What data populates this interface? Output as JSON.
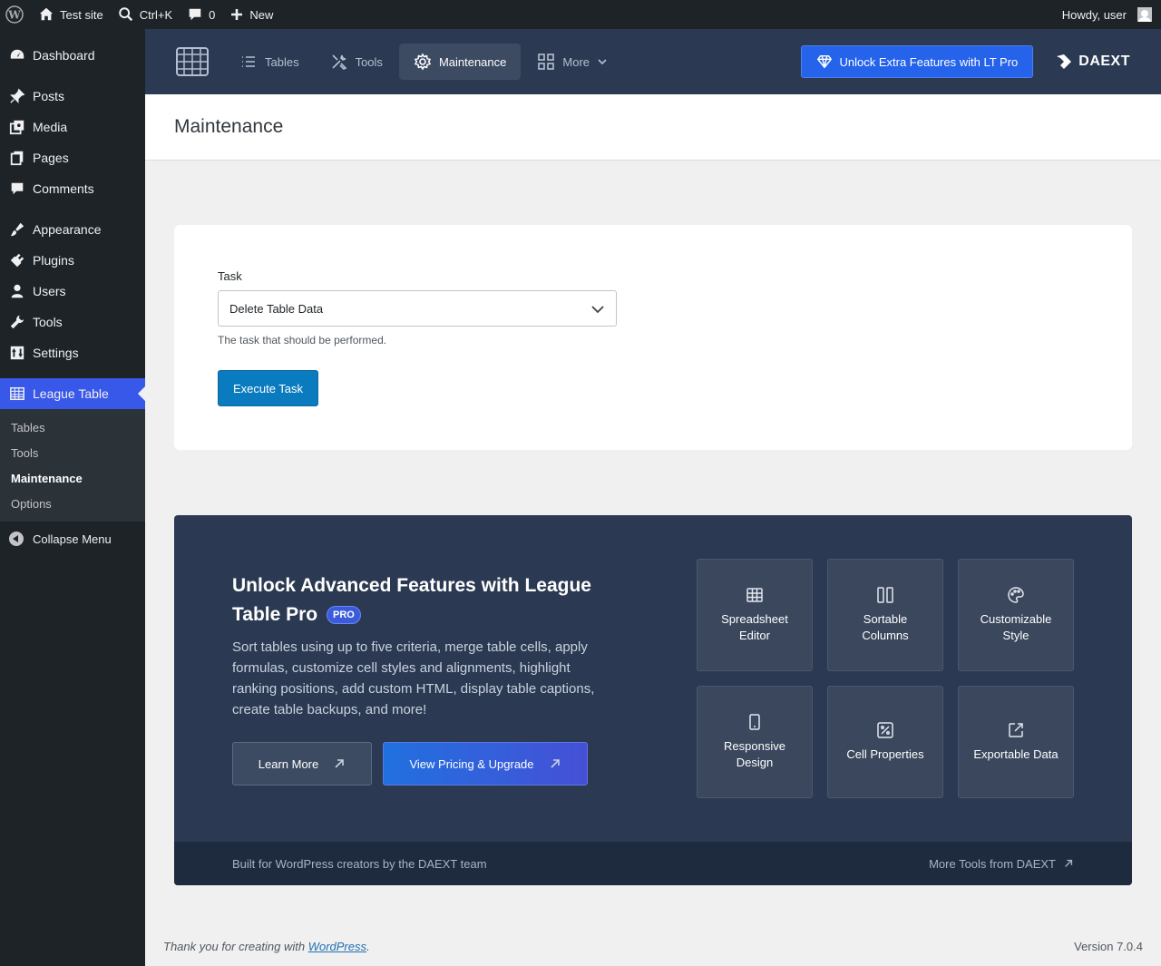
{
  "adminbar": {
    "site_name": "Test site",
    "search_shortcut": "Ctrl+K",
    "comments_count": "0",
    "new_label": "New",
    "howdy": "Howdy, user"
  },
  "sidebar": {
    "items": [
      {
        "label": "Dashboard",
        "icon": "dashboard-icon"
      },
      {
        "label": "Posts",
        "icon": "pin-icon"
      },
      {
        "label": "Media",
        "icon": "media-icon"
      },
      {
        "label": "Pages",
        "icon": "pages-icon"
      },
      {
        "label": "Comments",
        "icon": "comment-icon"
      },
      {
        "label": "Appearance",
        "icon": "brush-icon"
      },
      {
        "label": "Plugins",
        "icon": "plug-icon"
      },
      {
        "label": "Users",
        "icon": "user-icon"
      },
      {
        "label": "Tools",
        "icon": "wrench-icon"
      },
      {
        "label": "Settings",
        "icon": "settings-icon"
      },
      {
        "label": "League Table",
        "icon": "table-icon"
      }
    ],
    "submenu": [
      "Tables",
      "Tools",
      "Maintenance",
      "Options"
    ],
    "collapse_label": "Collapse Menu"
  },
  "plugin_nav": {
    "tabs": [
      "Tables",
      "Tools",
      "Maintenance",
      "More"
    ],
    "unlock_label": "Unlock Extra Features with LT Pro",
    "brand": "DAEXT"
  },
  "page": {
    "title": "Maintenance"
  },
  "task_form": {
    "label": "Task",
    "selected": "Delete Table Data",
    "help": "The task that should be performed.",
    "execute_label": "Execute Task"
  },
  "promo": {
    "title": "Unlock Advanced Features with League Table Pro",
    "badge": "PRO",
    "description": "Sort tables using up to five criteria, merge table cells, apply formulas, customize cell styles and alignments, highlight ranking positions, add custom HTML, display table captions, create table backups, and more!",
    "learn_more": "Learn More",
    "pricing": "View Pricing & Upgrade",
    "features": [
      {
        "label": "Spreadsheet Editor",
        "icon": "grid-icon"
      },
      {
        "label": "Sortable Columns",
        "icon": "columns-icon"
      },
      {
        "label": "Customizable Style",
        "icon": "palette-icon"
      },
      {
        "label": "Responsive Design",
        "icon": "mobile-icon"
      },
      {
        "label": "Cell Properties",
        "icon": "percent-icon"
      },
      {
        "label": "Exportable Data",
        "icon": "export-icon"
      }
    ],
    "footer_left": "Built for WordPress creators by the DAEXT team",
    "footer_right": "More Tools from DAEXT"
  },
  "footer": {
    "thanks_prefix": "Thank you for creating with ",
    "link": "WordPress",
    "thanks_suffix": ".",
    "version": "Version 7.0.4"
  },
  "colors": {
    "admin_bar": "#1d2327",
    "plugin_nav": "#2b3a52",
    "accent": "#3858e9",
    "execute": "#0a7bbf",
    "unlock": "#2563eb"
  }
}
